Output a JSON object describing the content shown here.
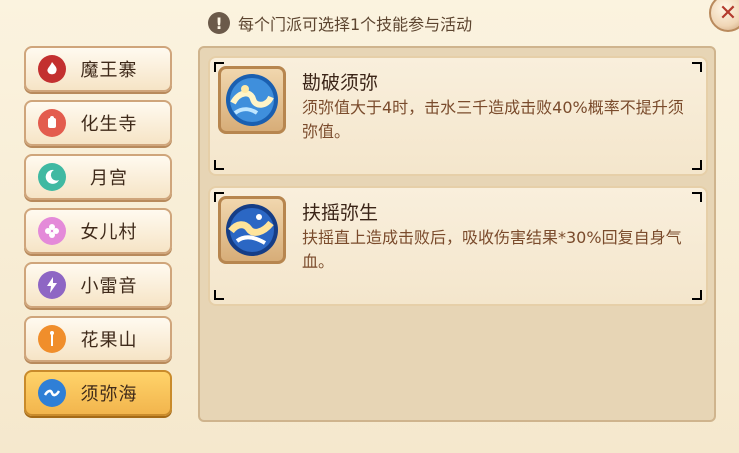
{
  "notice": {
    "icon": "exclamation-icon",
    "text": "每个门派可选择1个技能参与活动"
  },
  "close": {
    "icon": "close-icon",
    "glyph": "✕"
  },
  "sects": [
    {
      "label": "魔王寨",
      "icon": "demon-flame-icon",
      "color": "#c33030",
      "active": false
    },
    {
      "label": "化生寺",
      "icon": "buddha-icon",
      "color": "#e35c4e",
      "active": false
    },
    {
      "label": "月宫",
      "icon": "moon-icon",
      "color": "#40b9a2",
      "active": false
    },
    {
      "label": "女儿村",
      "icon": "flower-icon",
      "color": "#e48ad9",
      "active": false
    },
    {
      "label": "小雷音",
      "icon": "thunder-icon",
      "color": "#8e66c4",
      "active": false
    },
    {
      "label": "花果山",
      "icon": "staff-icon",
      "color": "#f08e2b",
      "active": false
    },
    {
      "label": "须弥海",
      "icon": "wave-icon",
      "color": "#2f7fd6",
      "active": true
    }
  ],
  "skills": [
    {
      "name": "勘破须弥",
      "desc": "须弥值大于4时，击水三千造成击败40%概率不提升须弥值。",
      "icon": "wave-swirl-icon"
    },
    {
      "name": "扶摇弥生",
      "desc": "扶摇直上造成击败后，吸收伤害结果*30%回复自身气血。",
      "icon": "cloud-swirl-icon"
    }
  ]
}
